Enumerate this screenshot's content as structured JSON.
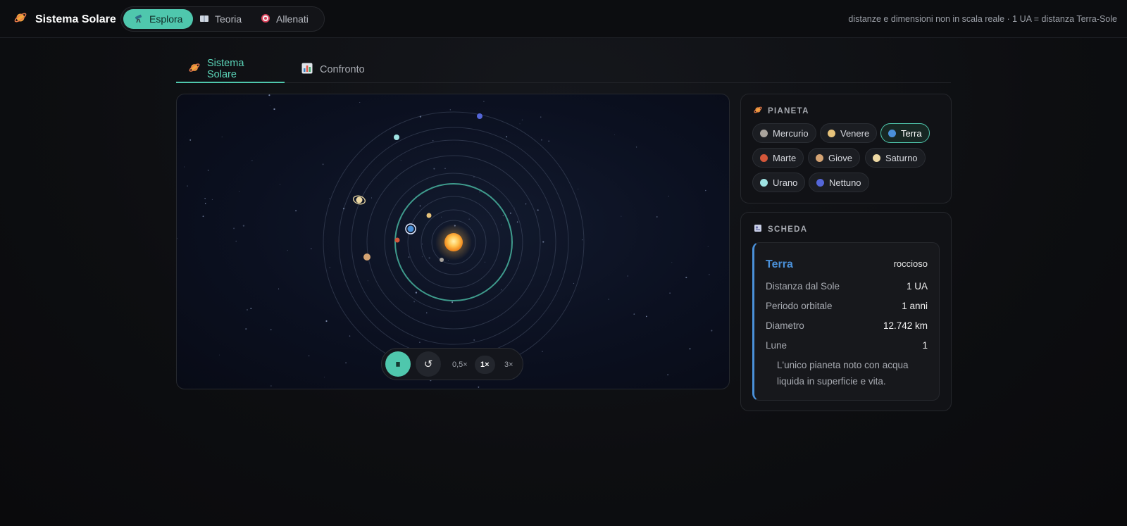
{
  "app": {
    "title": "Sistema Solare",
    "logo_icon": "ringed-planet-icon"
  },
  "nav": {
    "items": [
      {
        "label": "Esplora",
        "icon": "telescope-icon",
        "active": true
      },
      {
        "label": "Teoria",
        "icon": "book-icon",
        "active": false
      },
      {
        "label": "Allenati",
        "icon": "target-icon",
        "active": false
      }
    ]
  },
  "topbar": {
    "note": "distanze e dimensioni non in scala reale · 1 UA = distanza Terra-Sole"
  },
  "tabs": [
    {
      "label": "Sistema Solare",
      "icon": "ringed-planet-icon",
      "active": true
    },
    {
      "label": "Confronto",
      "icon": "bar-chart-icon",
      "active": false
    }
  ],
  "controls": {
    "play_icon": "pause-icon",
    "play_glyph": "⏸",
    "reset_icon": "reset-icon",
    "reset_glyph": "↺",
    "speeds": [
      "0,5×",
      "1×",
      "3×"
    ],
    "active_speed": "1×"
  },
  "planet_panel": {
    "title": "PIANETA",
    "planets": [
      {
        "name": "Mercurio",
        "color": "#a9a39c"
      },
      {
        "name": "Venere",
        "color": "#e6c27a"
      },
      {
        "name": "Terra",
        "color": "#4a90d9",
        "selected": true
      },
      {
        "name": "Marte",
        "color": "#d4573a"
      },
      {
        "name": "Giove",
        "color": "#d4a373"
      },
      {
        "name": "Saturno",
        "color": "#eed9a4"
      },
      {
        "name": "Urano",
        "color": "#9fe3e3"
      },
      {
        "name": "Nettuno",
        "color": "#5466d8"
      }
    ]
  },
  "card_panel": {
    "title": "SCHEDA",
    "name": "Terra",
    "type": "roccioso",
    "rows": [
      {
        "label": "Distanza dal Sole",
        "value": "1 UA"
      },
      {
        "label": "Periodo orbitale",
        "value": "1 anni"
      },
      {
        "label": "Diametro",
        "value": "12.742 km"
      },
      {
        "label": "Lune",
        "value": "1"
      }
    ],
    "description": "L'unico pianeta noto con acqua liquida in superficie e vita."
  },
  "colors": {
    "accent": "#4fc7ad",
    "earth": "#4a90d9",
    "sun": "#ffb84a"
  }
}
